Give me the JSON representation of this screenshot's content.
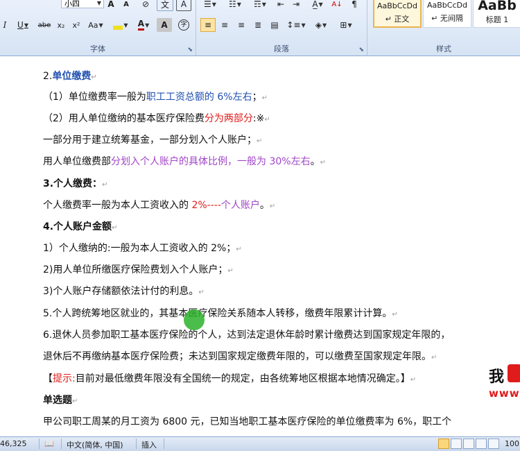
{
  "ribbon": {
    "font_group": {
      "label": "字体",
      "font_size": "小四",
      "row1": [
        "A",
        "A",
        "⊘",
        "文",
        "A"
      ],
      "row2": [
        "I",
        "U",
        "abe",
        "x₂",
        "x²",
        "Aa"
      ]
    },
    "paragraph_group": {
      "label": "段落"
    },
    "style_group": {
      "label": "样式",
      "styles": [
        {
          "sample": "AaBbCcDd",
          "name": "↵ 正文"
        },
        {
          "sample": "AaBbCcDd",
          "name": "↵ 无间隔"
        },
        {
          "sample": "AaBb",
          "name": "标题 1"
        }
      ]
    }
  },
  "document": {
    "lines": [
      {
        "segments": [
          {
            "t": "2.",
            "c": ""
          },
          {
            "t": "单位缴费",
            "c": "blue b"
          },
          {
            "t": "↵",
            "c": "pm"
          }
        ]
      },
      {
        "segments": [
          {
            "t": "（1）单位缴费率一般为",
            "c": ""
          },
          {
            "t": "职工工资总额的 6%左右",
            "c": "blue"
          },
          {
            "t": "；",
            "c": ""
          },
          {
            "t": "↵",
            "c": "pm"
          }
        ]
      },
      {
        "segments": [
          {
            "t": "（2）用人单位缴纳的基本医疗保险费",
            "c": ""
          },
          {
            "t": "分为两部分",
            "c": "red"
          },
          {
            "t": ":※",
            "c": ""
          },
          {
            "t": "↵",
            "c": "pm"
          }
        ]
      },
      {
        "segments": [
          {
            "t": "一部分用于建立统筹基金，一部分划入个人账户；",
            "c": ""
          },
          {
            "t": "↵",
            "c": "pm"
          }
        ]
      },
      {
        "segments": [
          {
            "t": "用人单位缴费部",
            "c": ""
          },
          {
            "t": "分划入个人账户的具体比例，一般为 30%左右",
            "c": "purple"
          },
          {
            "t": "。",
            "c": ""
          },
          {
            "t": "↵",
            "c": "pm"
          }
        ]
      },
      {
        "segments": [
          {
            "t": "3.个人缴费：",
            "c": "b"
          },
          {
            "t": "↵",
            "c": "pm"
          }
        ]
      },
      {
        "segments": [
          {
            "t": "  个人缴费率一般为本人工资收入的 ",
            "c": ""
          },
          {
            "t": "2%----",
            "c": "red"
          },
          {
            "t": "个人账户",
            "c": "purple"
          },
          {
            "t": "。",
            "c": ""
          },
          {
            "t": "↵",
            "c": "pm"
          }
        ]
      },
      {
        "segments": [
          {
            "t": "4.个人账户金额",
            "c": "b"
          },
          {
            "t": "↵",
            "c": "pm"
          }
        ]
      },
      {
        "segments": [
          {
            "t": "  1）个人缴纳的:一般为本人工资收入的 2%；",
            "c": ""
          },
          {
            "t": "↵",
            "c": "pm"
          }
        ]
      },
      {
        "segments": [
          {
            "t": "  2)用人单位所缴医疗保险费划入个人账户；",
            "c": ""
          },
          {
            "t": "↵",
            "c": "pm"
          }
        ]
      },
      {
        "segments": [
          {
            "t": "  3)个人账户存储额依法计付的利息。",
            "c": ""
          },
          {
            "t": "↵",
            "c": "pm"
          }
        ]
      },
      {
        "segments": [
          {
            "t": "5.个人跨统筹地区就业的，其基本医疗保险关系随本人转移，缴费年限累计计算。",
            "c": ""
          },
          {
            "t": "↵",
            "c": "pm"
          }
        ]
      },
      {
        "segments": [
          {
            "t": "6.退休人员参加职工基本医疗保险的个人，达到法定退休年龄时累计缴费达到国家规定年限的，",
            "c": ""
          }
        ]
      },
      {
        "segments": [
          {
            "t": "退休后不再缴纳基本医疗保险费；未达到国家规定缴费年限的，可以缴费至国家规定年限。",
            "c": ""
          },
          {
            "t": "↵",
            "c": "pm"
          }
        ]
      },
      {
        "segments": [
          {
            "t": "【",
            "c": ""
          },
          {
            "t": "提示:",
            "c": "red"
          },
          {
            "t": "目前对最低缴费年限没有全国统一的规定，由各统筹地区根据本地情况确定。】",
            "c": ""
          },
          {
            "t": "↵",
            "c": "pm"
          }
        ]
      },
      {
        "segments": [
          {
            "t": "单选题",
            "c": "b"
          },
          {
            "t": "↵",
            "c": "pm"
          }
        ]
      },
      {
        "segments": [
          {
            "t": "甲公司职工周某的月工资为 6800 元，已知当地职工基本医疗保险的单位缴费率为 6%，职工个",
            "c": ""
          }
        ]
      }
    ]
  },
  "watermark": {
    "line1": "我",
    "line2": "www"
  },
  "statusbar": {
    "word_count": "46,325",
    "language": "中文(简体, 中国)",
    "insert_mode": "插入",
    "zoom": "100"
  }
}
